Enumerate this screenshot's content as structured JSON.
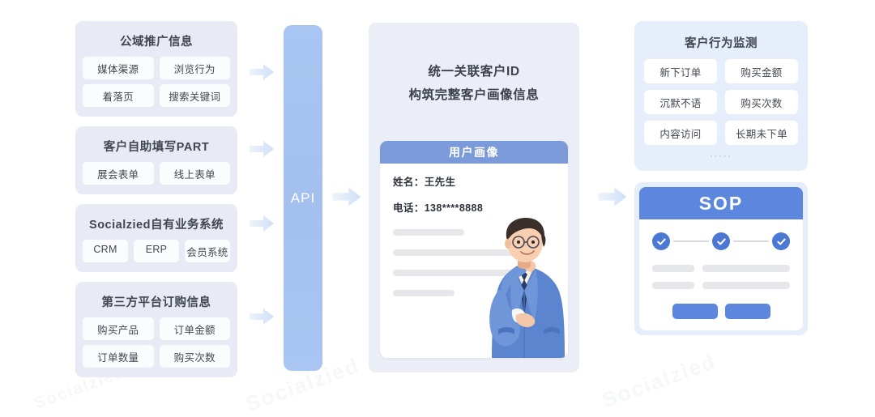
{
  "left_column": {
    "cards": [
      {
        "title": "公域推广信息",
        "rows": [
          [
            "媒体渠源",
            "浏览行为"
          ],
          [
            "着落页",
            "搜索关键词"
          ]
        ]
      },
      {
        "title": "客户自助填写PART",
        "rows": [
          [
            "展会表单",
            "线上表单"
          ]
        ]
      },
      {
        "title": "Socialzied自有业务系统",
        "rows": [
          [
            "CRM",
            "ERP",
            "会员系统"
          ]
        ]
      },
      {
        "title": "第三方平台订购信息",
        "rows": [
          [
            "购买产品",
            "订单金额"
          ],
          [
            "订单数量",
            "购买次数"
          ]
        ]
      }
    ]
  },
  "api": {
    "label": "API"
  },
  "center": {
    "heading_line1": "统一关联客户ID",
    "heading_line2": "构筑完整客户画像信息",
    "profile": {
      "header": "用户画像",
      "name_line": "姓名：王先生",
      "phone_line": "电话：138****8888"
    }
  },
  "right_column": {
    "behavior": {
      "title": "客户行为监测",
      "rows": [
        [
          "新下订单",
          "购买金额"
        ],
        [
          "沉默不语",
          "购买次数"
        ],
        [
          "内容访问",
          "长期未下单"
        ]
      ],
      "more": "·····"
    },
    "sop": {
      "title": "SOP"
    }
  },
  "watermarks": {
    "w1": "Socialzied",
    "w2": "Socialzied",
    "w3": "Socialzied"
  },
  "colors": {
    "page_background": "#ffffff",
    "source_card_bg": "#e8eaf6",
    "chip_bg": "#fbfcfe",
    "api_bar": "#a9c5f2",
    "center_panel_bg": "#eceef7",
    "profile_header": "#7a9ada",
    "behavior_card_bg": "#e6eefb",
    "sop_header": "#5d87de",
    "step_dot": "#4b78d4",
    "arrow": "#d6e2f5",
    "placeholder_bar": "#e6e7ea",
    "text_primary": "#41464f"
  }
}
